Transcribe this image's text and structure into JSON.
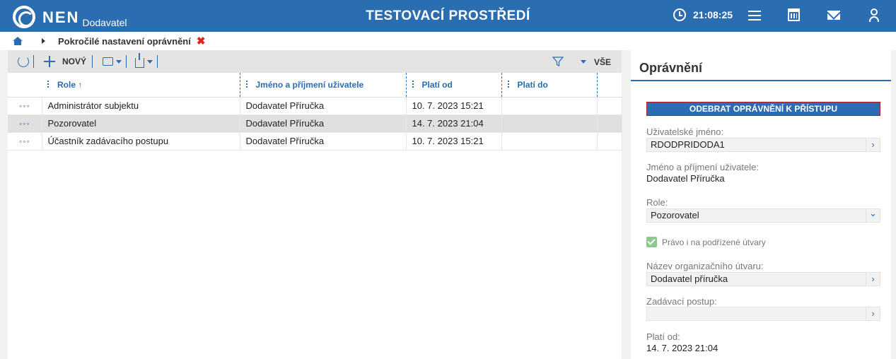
{
  "header": {
    "logo_text": "NEN",
    "logo_sub": "Dodavatel",
    "env_title": "TESTOVACÍ PROSTŘEDÍ",
    "time": "21:08:25"
  },
  "breadcrumb": {
    "current": "Pokročilé nastavení oprávnění",
    "close_glyph": "✖"
  },
  "toolbar": {
    "new_label": "NOVÝ",
    "filter_label": "VŠE"
  },
  "table": {
    "columns": [
      "Role ↑",
      "Jméno a příjmení uživatele",
      "Platí od",
      "Platí do"
    ],
    "rows": [
      {
        "role": "Administrátor subjektu",
        "name": "Dodavatel Příručka",
        "from": "10. 7. 2023 15:21",
        "to": ""
      },
      {
        "role": "Pozorovatel",
        "name": "Dodavatel Příručka",
        "from": "14. 7. 2023 21:04",
        "to": ""
      },
      {
        "role": "Účastník zadávacího postupu",
        "name": "Dodavatel Příručka",
        "from": "10. 7. 2023 15:21",
        "to": ""
      }
    ],
    "row_actions": "◦◦◦"
  },
  "detail": {
    "title": "Oprávnění",
    "remove_button": "ODEBRAT OPRÁVNĚNÍ K PŘÍSTUPU",
    "username_label": "Uživatelské jméno:",
    "username_value": "RDODPRIDODA1",
    "fullname_label": "Jméno a příjmení uživatele:",
    "fullname_value": "Dodavatel Příručka",
    "role_label": "Role:",
    "role_value": "Pozorovatel",
    "subunits_label": "Právo i na podřízené útvary",
    "subunits_checked": true,
    "org_label": "Název organizačního útvaru:",
    "org_value": "Dodavatel příručka",
    "procedure_label": "Zadávací postup:",
    "procedure_value": "",
    "valid_from_label": "Platí od:",
    "valid_from_value": "14. 7. 2023 21:04",
    "chevron_right": "›",
    "chevron_down": "⌄"
  },
  "colors": {
    "primary": "#2a6db0",
    "close_red": "#e0231c",
    "selected_row": "#e0e0e0",
    "check_green": "#8dc88d"
  }
}
